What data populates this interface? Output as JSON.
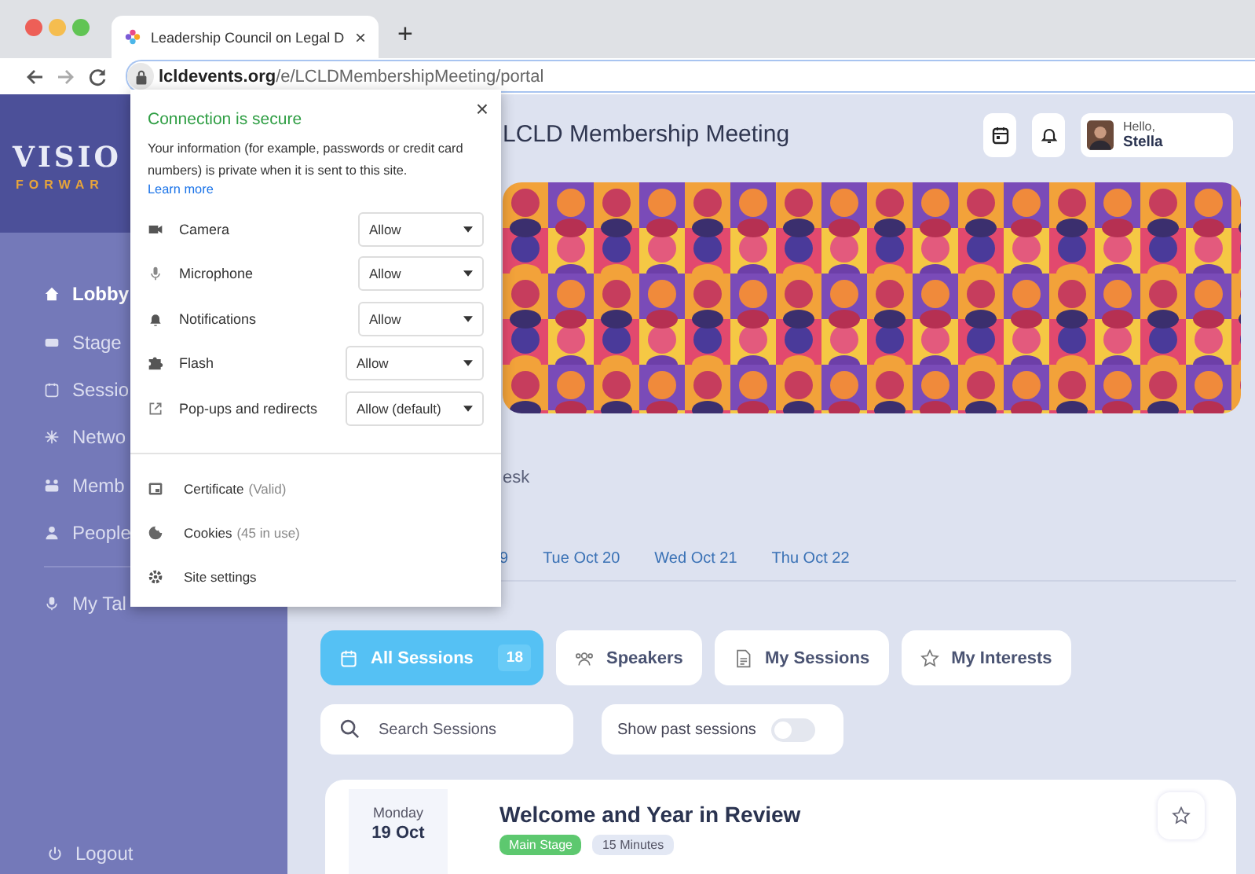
{
  "browser": {
    "tab": {
      "title": "Leadership Council on Legal D",
      "close": "×"
    },
    "new_tab": "+",
    "url": {
      "domain": "lcldevents.org",
      "path": "/e/LCLDMembershipMeeting/portal"
    }
  },
  "sidebar": {
    "logo": {
      "word": "VISIO",
      "tagline": "FORWAR"
    },
    "items": [
      {
        "label": "Lobby",
        "selected": true
      },
      {
        "label": "Stage",
        "selected": false
      },
      {
        "label": "Sessio",
        "selected": false
      },
      {
        "label": "Netwo",
        "selected": false
      },
      {
        "label": "Memb",
        "selected": false
      },
      {
        "label": "People",
        "selected": false
      }
    ],
    "secondary": [
      {
        "label": "My Tal",
        "selected": false
      }
    ],
    "logout": "Logout"
  },
  "header": {
    "title": "LCLD Membership Meeting",
    "user": {
      "greeting": "Hello,",
      "name": "Stella"
    }
  },
  "banner": {
    "kind": "picture"
  },
  "section_label": "esk",
  "date_tabs": [
    "9",
    "Tue Oct 20",
    "Wed Oct 21",
    "Thu Oct 22"
  ],
  "session_tabs": [
    {
      "label": "All Sessions",
      "count": "18",
      "selected": true
    },
    {
      "label": "Speakers",
      "selected": false
    },
    {
      "label": "My Sessions",
      "selected": false
    },
    {
      "label": "My Interests",
      "selected": false
    }
  ],
  "search": {
    "placeholder": "Search Sessions"
  },
  "past_toggle": {
    "label": "Show past sessions",
    "on": false
  },
  "sessions": [
    {
      "weekday": "Monday",
      "date": "19 Oct",
      "title": "Welcome and Year in Review",
      "tags": [
        {
          "label": "Main Stage",
          "color": "#5dc86f"
        },
        {
          "label": "15 Minutes",
          "color": "#e3e8f4"
        }
      ]
    }
  ],
  "site_info": {
    "title": "Connection is secure",
    "body": "Your information (for example, passwords or credit card numbers) is private when it is sent to this site.",
    "link": "Learn more",
    "close": "×",
    "permissions": [
      {
        "label": "Camera",
        "value": "Allow"
      },
      {
        "label": "Microphone",
        "value": "Allow"
      },
      {
        "label": "Notifications",
        "value": "Allow"
      },
      {
        "label": "Flash",
        "value": "Allow"
      },
      {
        "label": "Pop-ups and redirects",
        "value": "Allow (default)"
      }
    ],
    "links": [
      {
        "label": "Certificate",
        "detail": "(Valid)"
      },
      {
        "label": "Cookies",
        "detail": "(45 in use)"
      },
      {
        "label": "Site settings"
      }
    ]
  }
}
